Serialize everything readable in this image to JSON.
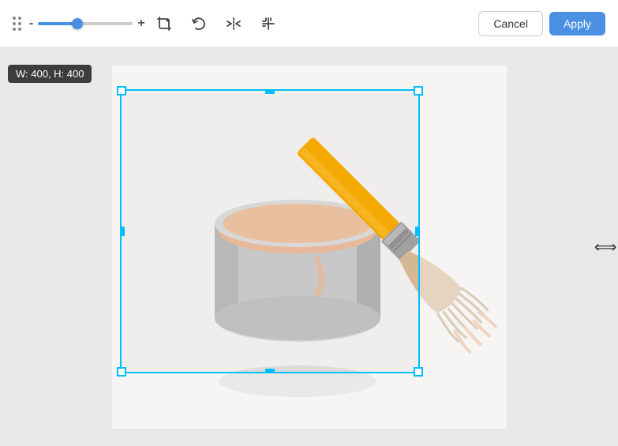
{
  "toolbar": {
    "slider_min": "-",
    "slider_max": "+",
    "slider_value": 40,
    "cancel_label": "Cancel",
    "apply_label": "Apply",
    "icons": {
      "crop": "crop-icon",
      "undo": "undo-icon",
      "flip": "flip-icon",
      "aspect": "aspect-icon"
    }
  },
  "canvas": {
    "dimensions_label": "W: 400, H: 400",
    "crop_width": 400,
    "crop_height": 400
  }
}
